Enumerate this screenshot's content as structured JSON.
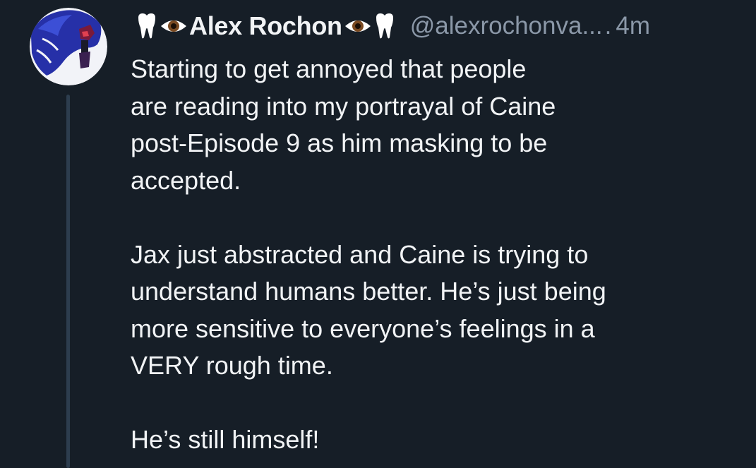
{
  "post": {
    "author": {
      "display_name": "Alex Rochon",
      "handle": "@alexrochonva...",
      "emoji_left": [
        "tooth-icon",
        "eye-icon"
      ],
      "emoji_right": [
        "eye-icon",
        "tooth-icon"
      ]
    },
    "separator": ".",
    "time": "4m",
    "body_lines": [
      "Starting to get annoyed that people",
      "are reading into my portrayal of Caine",
      "post-Episode 9 as him masking to be",
      "accepted.",
      "",
      "Jax just abstracted and Caine is trying to",
      "understand humans better. He’s just being",
      "more sensitive to everyone’s feelings in a",
      "VERY rough time.",
      "",
      "He’s still himself!"
    ]
  },
  "colors": {
    "background": "#161e27",
    "text": "#f1f3f5",
    "muted": "#8b98a8",
    "thread_line": "#2d3d4e"
  }
}
